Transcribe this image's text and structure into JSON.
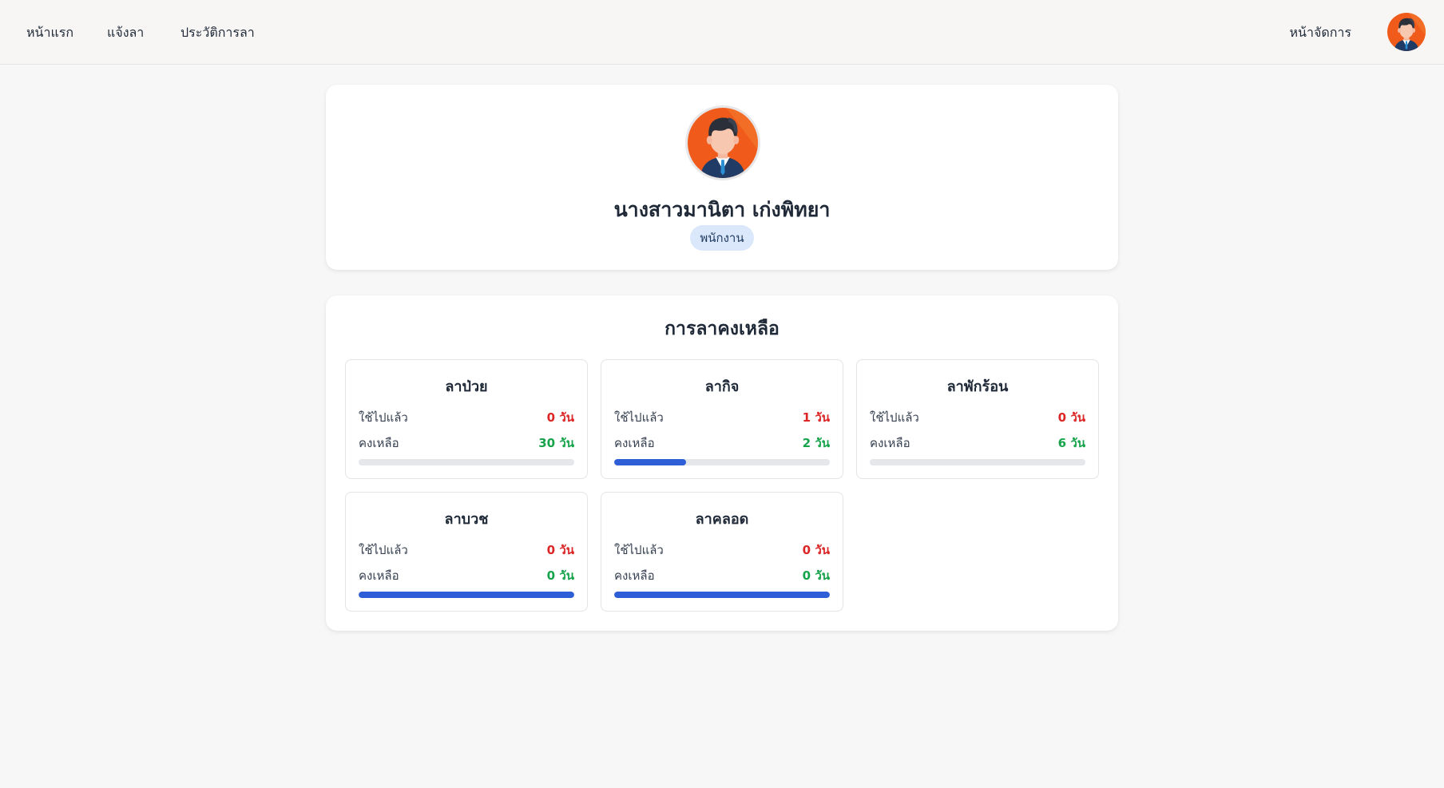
{
  "nav": {
    "home": "หน้าแรก",
    "leave": "แจ้งลา",
    "history": "ประวัติการลา",
    "admin": "หน้าจัดการ",
    "avatar_icon": "user-avatar-icon"
  },
  "profile": {
    "name": "นางสาวมานิตา เก่งพิทยา",
    "role": "พนักงาน",
    "avatar_icon": "user-avatar-icon"
  },
  "leave_summary": {
    "title": "การลาคงเหลือ",
    "used_label": "ใช้ไปแล้ว",
    "remaining_label": "คงเหลือ",
    "items": [
      {
        "name": "ลาป่วย",
        "used": "0 วัน",
        "remaining": "30 วัน",
        "progress_fraction": 0.0
      },
      {
        "name": "ลากิจ",
        "used": "1 วัน",
        "remaining": "2 วัน",
        "progress_fraction": 0.333
      },
      {
        "name": "ลาพักร้อน",
        "used": "0 วัน",
        "remaining": "6 วัน",
        "progress_fraction": 0.0
      },
      {
        "name": "ลาบวช",
        "used": "0 วัน",
        "remaining": "0 วัน",
        "progress_fraction": 1.0
      },
      {
        "name": "ลาคลอด",
        "used": "0 วัน",
        "remaining": "0 วัน",
        "progress_fraction": 1.0
      }
    ]
  },
  "colors": {
    "used": "#dc2626",
    "remaining": "#16a34a",
    "progress": "#2f5fd6",
    "avatar_bg": "#f05a1a"
  }
}
